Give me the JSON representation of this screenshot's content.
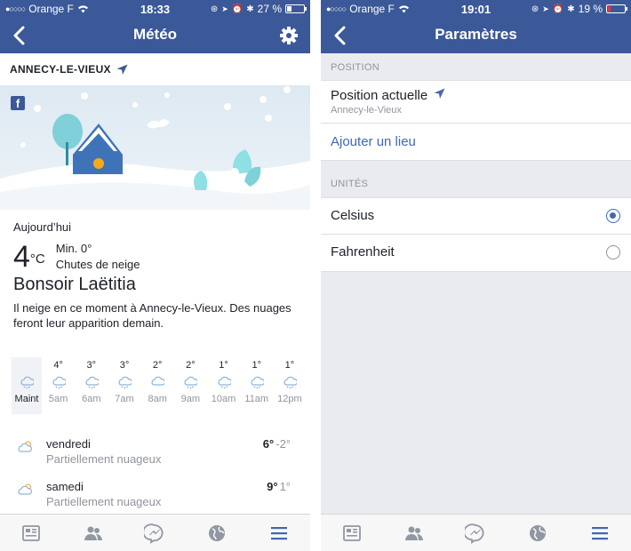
{
  "left": {
    "status": {
      "carrier": "Orange F",
      "time": "18:33",
      "battery": "27 %"
    },
    "nav": {
      "title": "Météo"
    },
    "location": "ANNECY-LE-VIEUX",
    "today": {
      "label": "Aujourd’hui",
      "temp": "4",
      "unit": "°C",
      "min": "Min. 0°",
      "condition": "Chutes de neige",
      "greeting": "Bonsoir Laëtitia",
      "description": "Il neige en ce moment à Annecy-le-Vieux. Des nuages feront leur apparition demain."
    },
    "hourly": [
      {
        "temp": "",
        "time": "Maint",
        "icon": "snow-cloud-icon",
        "now": true
      },
      {
        "temp": "4°",
        "time": "5am",
        "icon": "snow-cloud-icon"
      },
      {
        "temp": "3°",
        "time": "6am",
        "icon": "snow-cloud-icon"
      },
      {
        "temp": "3°",
        "time": "7am",
        "icon": "snow-cloud-icon"
      },
      {
        "temp": "2°",
        "time": "8am",
        "icon": "cloud-icon"
      },
      {
        "temp": "2°",
        "time": "9am",
        "icon": "snow-cloud-icon"
      },
      {
        "temp": "1°",
        "time": "10am",
        "icon": "snow-cloud-icon"
      },
      {
        "temp": "1°",
        "time": "11am",
        "icon": "snow-cloud-icon"
      },
      {
        "temp": "1°",
        "time": "12pm",
        "icon": "snow-cloud-icon"
      }
    ],
    "daily": [
      {
        "day": "vendredi",
        "condition": "Partiellement nuageux",
        "max": "6°",
        "min": "-2°",
        "icon": "partly-cloudy-icon"
      },
      {
        "day": "samedi",
        "condition": "Partiellement nuageux",
        "max": "9°",
        "min": "1°",
        "icon": "partly-cloudy-icon"
      }
    ]
  },
  "right": {
    "status": {
      "carrier": "Orange F",
      "time": "19:01",
      "battery": "19 %"
    },
    "nav": {
      "title": "Paramètres"
    },
    "position_section": {
      "header": "POSITION",
      "current_title": "Position actuelle",
      "current_sub": "Annecy-le-Vieux",
      "add_place": "Ajouter un lieu"
    },
    "units_section": {
      "header": "UNITÉS",
      "options": [
        {
          "label": "Celsius",
          "selected": true
        },
        {
          "label": "Fahrenheit",
          "selected": false
        }
      ]
    }
  },
  "tabs": [
    "news-feed-icon",
    "friends-icon",
    "messenger-icon",
    "globe-icon",
    "menu-icon"
  ],
  "colors": {
    "brand": "#3b5998",
    "link": "#4267b2",
    "muted": "#90949c",
    "battery_low": "#e53935"
  },
  "battery_levels": {
    "left": 0.27,
    "right": 0.19
  }
}
